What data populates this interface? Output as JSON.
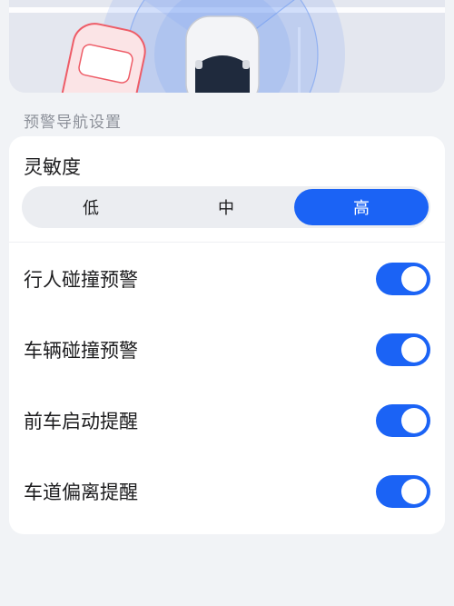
{
  "colors": {
    "accent": "#1b63f5",
    "page_bg": "#f1f3f6",
    "card_bg": "#ffffff"
  },
  "hero": {
    "icons": [
      "pedestrian-warning-car-illustration",
      "radar-sweep-icon"
    ]
  },
  "section": {
    "title": "预警导航设置"
  },
  "sensitivity": {
    "label": "灵敏度",
    "options": [
      "低",
      "中",
      "高"
    ],
    "selected": "高"
  },
  "settings": [
    {
      "label": "行人碰撞预警",
      "enabled": true
    },
    {
      "label": "车辆碰撞预警",
      "enabled": true
    },
    {
      "label": "前车启动提醒",
      "enabled": true
    },
    {
      "label": "车道偏离提醒",
      "enabled": true
    }
  ]
}
